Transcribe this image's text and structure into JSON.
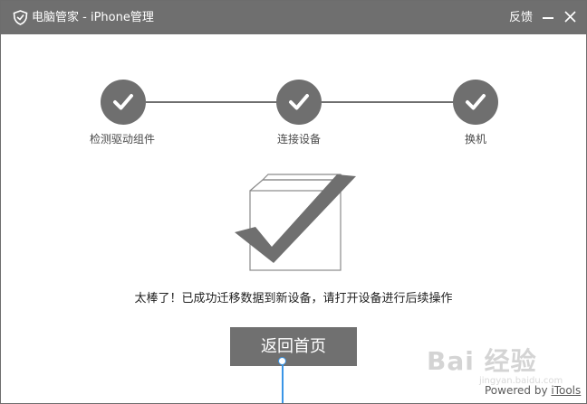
{
  "window": {
    "title": "电脑管家 - iPhone管理",
    "feedback": "反馈",
    "minimize_icon": "minimize-icon",
    "close_icon": "close-icon"
  },
  "steps": [
    {
      "label": "检测驱动组件",
      "status": "done"
    },
    {
      "label": "连接设备",
      "status": "done"
    },
    {
      "label": "换机",
      "status": "done"
    }
  ],
  "message": "太棒了！已成功迁移数据到新设备，请打开设备进行后续操作",
  "home_button": "返回首页",
  "watermark": {
    "main": "Bai 经验",
    "sub": "jingyan.baidu.com"
  },
  "powered_by": {
    "prefix": "Powered by ",
    "brand": "iTools"
  },
  "colors": {
    "titlebar": "#6f6f6f",
    "step": "#6f6f6f",
    "button": "#707070",
    "pointer": "#3a95e6"
  }
}
